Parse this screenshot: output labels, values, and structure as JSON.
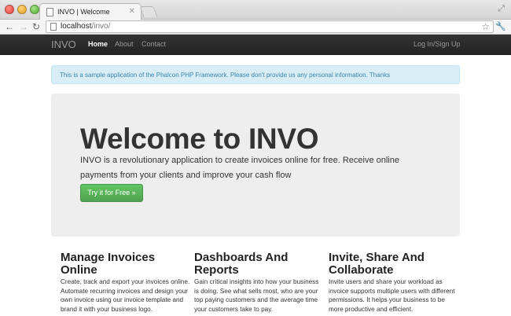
{
  "browser": {
    "tab_title": "INVO | Welcome",
    "url_host": "localhost",
    "url_path": "/invo/"
  },
  "navbar": {
    "brand": "INVO",
    "links": [
      "Home",
      "About",
      "Contact"
    ],
    "login": "Log In/Sign Up"
  },
  "alert": {
    "text": "This is a sample application of the Phalcon PHP Framework. Please don't provide us any personal information. Thanks"
  },
  "hero": {
    "title": "Welcome to INVO",
    "text": "INVO is a revolutionary application to create invoices online for free. Receive online payments from your clients and improve your cash flow",
    "button": "Try it for Free »"
  },
  "features": [
    {
      "title": "Manage Invoices Online",
      "text": "Create, track and export your invoices online. Automate recurring invoices and design your own invoice using our invoice template and brand it with your business logo."
    },
    {
      "title": "Dashboards And Reports",
      "text": "Gain critical insights into how your business is doing. See what sells most, who are your top paying customers and the average time your customers take to pay."
    },
    {
      "title": "Invite, Share And Collaborate",
      "text": "Invite users and share your workload as invoice supports multiple users with different permissions. It helps your business to be more productive and efficient."
    }
  ],
  "colors": {
    "navbar": "#222222",
    "alert_bg": "#d9edf7",
    "alert_text": "#3a87ad",
    "hero_bg": "#eeeeee",
    "cta": "#51a351"
  }
}
